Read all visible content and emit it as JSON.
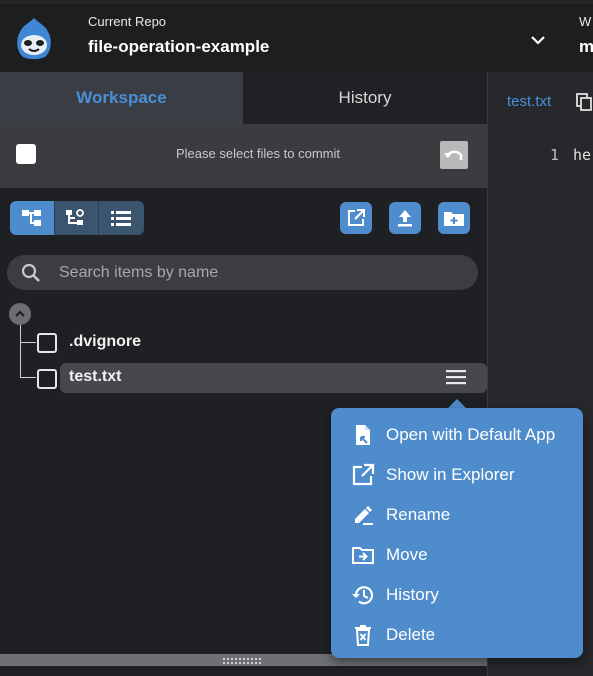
{
  "header": {
    "repo_label": "Current Repo",
    "repo_name": "file-operation-example",
    "branch_label": "W",
    "branch_name": "m"
  },
  "tabs": [
    {
      "label": "Workspace",
      "active": true
    },
    {
      "label": "History",
      "active": false
    }
  ],
  "commit": {
    "message": "Please select files to commit"
  },
  "search": {
    "placeholder": "Search items by name"
  },
  "files": [
    {
      "name": ".dvignore",
      "selected": false
    },
    {
      "name": "test.txt",
      "selected": true
    }
  ],
  "editor": {
    "tab_label": "test.txt",
    "line_number": "1",
    "line_text": "he"
  },
  "context_menu": {
    "items": [
      {
        "label": "Open with Default App",
        "icon": "file-open-icon"
      },
      {
        "label": "Show in Explorer",
        "icon": "open-external-icon"
      },
      {
        "label": "Rename",
        "icon": "pencil-icon"
      },
      {
        "label": "Move",
        "icon": "folder-move-icon"
      },
      {
        "label": "History",
        "icon": "history-icon"
      },
      {
        "label": "Delete",
        "icon": "trash-icon"
      }
    ]
  },
  "colors": {
    "accent": "#4f8ccb",
    "menu_background": "#4e8ccb",
    "panel_background": "#1f2023",
    "active_tab_text": "#4a8fd8"
  }
}
